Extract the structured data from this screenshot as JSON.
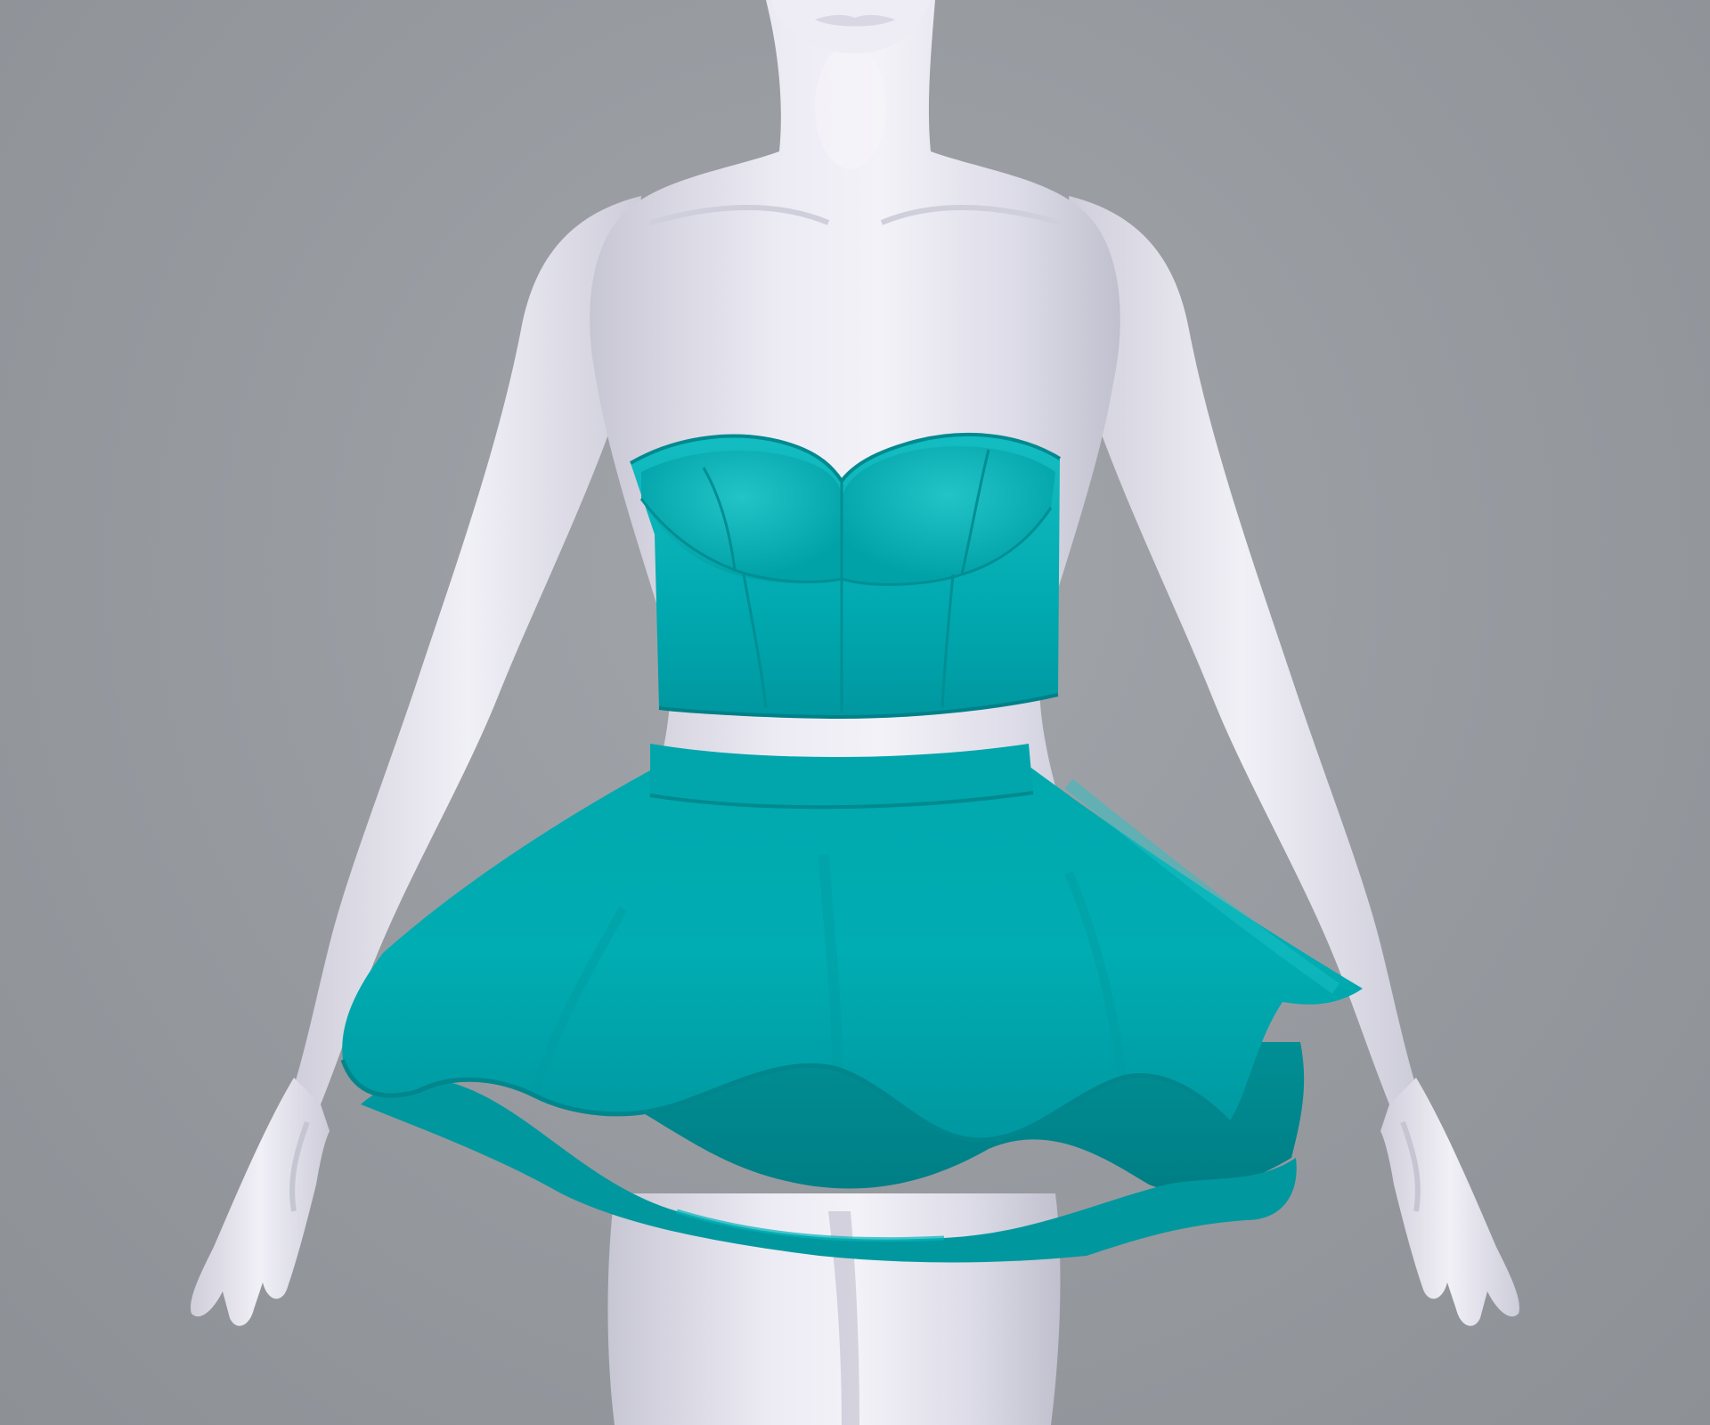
{
  "scene": {
    "subject": "mannequin-with-teal-outfit",
    "colors": {
      "background": "#979ba0",
      "mannequin_skin": "#e6e5ef",
      "mannequin_shadow": "#c3c2cf",
      "garment_teal": "#00abb0",
      "garment_teal_dark": "#008a8f",
      "garment_teal_light": "#18c0c4"
    },
    "garments": [
      "strapless-bustier-crop-top",
      "tiered-ruffle-mini-skirt"
    ]
  }
}
